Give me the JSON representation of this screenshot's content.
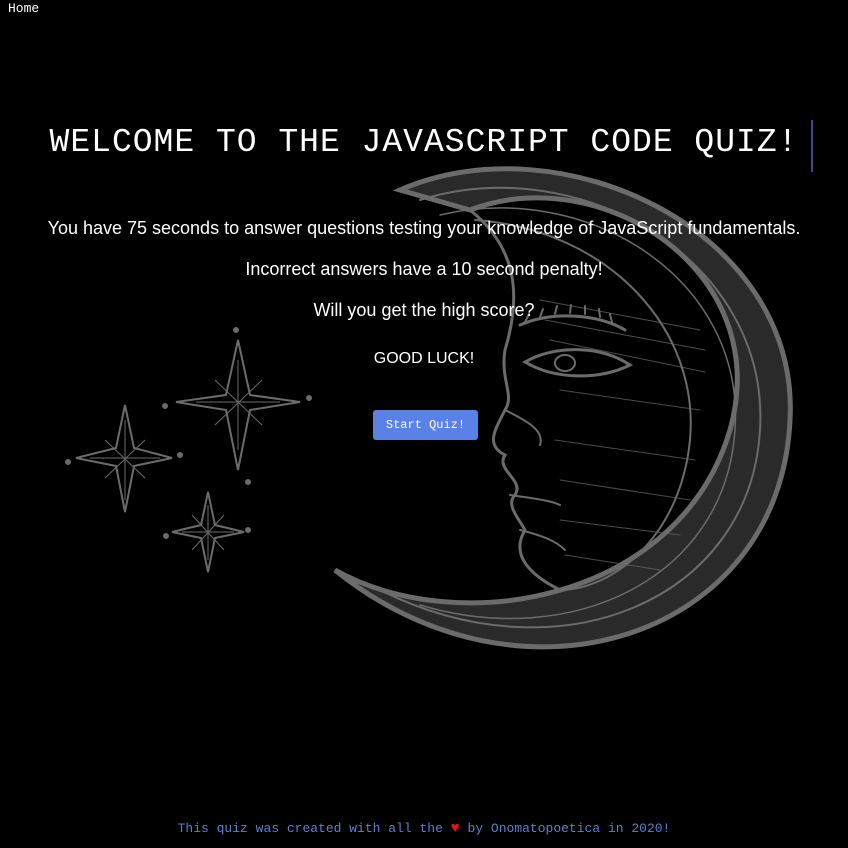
{
  "nav": {
    "home_label": "Home"
  },
  "header": {
    "title": "WELCOME TO THE JAVASCRIPT CODE QUIZ!"
  },
  "intro": {
    "line1": "You have 75 seconds to answer questions testing your knowledge of JavaScript fundamentals.",
    "line2": "Incorrect answers have a 10 second penalty!",
    "line3": "Will you get the high score?",
    "good_luck": "GOOD LUCK!"
  },
  "actions": {
    "start_label": "Start Quiz!"
  },
  "footer": {
    "prefix": "This quiz was created with all the",
    "heart": "♥",
    "suffix": "by Onomatopoetica in 2020!"
  },
  "colors": {
    "background": "#000000",
    "button": "#5a82e6",
    "footer_text": "#5a7fd6",
    "heart": "#e41515",
    "illustration": "#6b6b6b"
  },
  "icons": [
    "crescent-moon-illustration",
    "star-icon",
    "heart-icon"
  ]
}
